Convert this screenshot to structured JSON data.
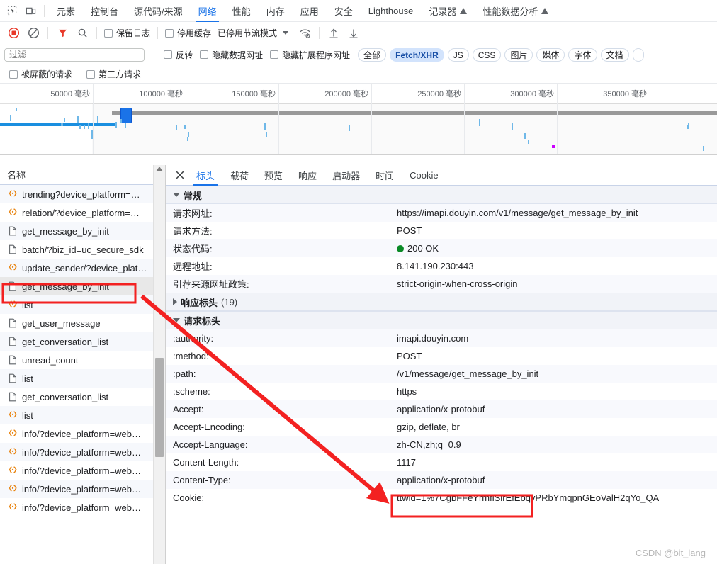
{
  "devtools": {
    "left_icons": [
      "inspect-element-icon",
      "device-toolbar-icon"
    ],
    "tabs": [
      {
        "label": "元素",
        "active": false,
        "warn": false
      },
      {
        "label": "控制台",
        "active": false,
        "warn": false
      },
      {
        "label": "源代码/来源",
        "active": false,
        "warn": false
      },
      {
        "label": "网络",
        "active": true,
        "warn": false
      },
      {
        "label": "性能",
        "active": false,
        "warn": false
      },
      {
        "label": "内存",
        "active": false,
        "warn": false
      },
      {
        "label": "应用",
        "active": false,
        "warn": false
      },
      {
        "label": "安全",
        "active": false,
        "warn": false
      },
      {
        "label": "Lighthouse",
        "active": false,
        "warn": false
      },
      {
        "label": "记录器",
        "active": false,
        "warn": true
      },
      {
        "label": "性能数据分析",
        "active": false,
        "warn": true
      }
    ]
  },
  "network_toolbar": {
    "record_icon": "record-stop-icon",
    "clear_icon": "clear-no-entry-icon",
    "filter_icon": "filter-funnel-icon",
    "search_icon": "search-icon",
    "preserve_log": "保留日志",
    "disable_cache": "停用缓存",
    "throttling": "已停用节流模式",
    "throttle_caret": "chevron-down-icon",
    "wifi_icon": "network-conditions-icon",
    "import_icon": "import-har-icon",
    "export_icon": "export-har-icon"
  },
  "filter_bar": {
    "placeholder": "过滤",
    "value": "",
    "invert": "反转",
    "hide_data_urls": "隐藏数据网址",
    "hide_extension_urls": "隐藏扩展程序网址",
    "types": [
      {
        "label": "全部",
        "selected": false
      },
      {
        "label": "Fetch/XHR",
        "selected": true
      },
      {
        "label": "JS",
        "selected": false
      },
      {
        "label": "CSS",
        "selected": false
      },
      {
        "label": "图片",
        "selected": false
      },
      {
        "label": "媒体",
        "selected": false
      },
      {
        "label": "字体",
        "selected": false
      },
      {
        "label": "文档",
        "selected": false
      }
    ],
    "blocked_requests": "被屏蔽的请求",
    "third_party": "第三方请求"
  },
  "overview": {
    "ticks": [
      "50000 毫秒",
      "100000 毫秒",
      "150000 毫秒",
      "200000 毫秒",
      "250000 毫秒",
      "300000 毫秒",
      "350000 毫秒"
    ]
  },
  "requests": {
    "column_header": "名称",
    "rows": [
      {
        "name": "trending?device_platform=…",
        "icon": "json-icon",
        "selected": false
      },
      {
        "name": "relation/?device_platform=…",
        "icon": "json-icon",
        "selected": false
      },
      {
        "name": "get_message_by_init",
        "icon": "doc-icon",
        "selected": false
      },
      {
        "name": "batch/?biz_id=uc_secure_sdk",
        "icon": "doc-icon",
        "selected": false
      },
      {
        "name": "update_sender/?device_plat…",
        "icon": "json-icon",
        "selected": false
      },
      {
        "name": "get_message_by_init",
        "icon": "doc-icon",
        "selected": true
      },
      {
        "name": "list",
        "icon": "json-icon",
        "selected": false
      },
      {
        "name": "get_user_message",
        "icon": "doc-icon",
        "selected": false
      },
      {
        "name": "get_conversation_list",
        "icon": "doc-icon",
        "selected": false
      },
      {
        "name": "unread_count",
        "icon": "doc-icon",
        "selected": false
      },
      {
        "name": "list",
        "icon": "doc-icon",
        "selected": false
      },
      {
        "name": "get_conversation_list",
        "icon": "doc-icon",
        "selected": false
      },
      {
        "name": "list",
        "icon": "json-icon",
        "selected": false
      },
      {
        "name": "info/?device_platform=web…",
        "icon": "json-icon",
        "selected": false
      },
      {
        "name": "info/?device_platform=web…",
        "icon": "json-icon",
        "selected": false
      },
      {
        "name": "info/?device_platform=web…",
        "icon": "json-icon",
        "selected": false
      },
      {
        "name": "info/?device_platform=web…",
        "icon": "json-icon",
        "selected": false
      },
      {
        "name": "info/?device_platform=web…",
        "icon": "json-icon",
        "selected": false
      }
    ]
  },
  "detail": {
    "close_label": "✕",
    "tabs": [
      {
        "label": "标头",
        "active": true
      },
      {
        "label": "载荷",
        "active": false
      },
      {
        "label": "预览",
        "active": false
      },
      {
        "label": "响应",
        "active": false
      },
      {
        "label": "启动器",
        "active": false
      },
      {
        "label": "时间",
        "active": false
      },
      {
        "label": "Cookie",
        "active": false
      }
    ],
    "general": {
      "title": "常规",
      "rows": [
        {
          "key": "请求网址:",
          "value": "https://imapi.douyin.com/v1/message/get_message_by_init",
          "status": false
        },
        {
          "key": "请求方法:",
          "value": "POST",
          "status": false
        },
        {
          "key": "状态代码:",
          "value": "200 OK",
          "status": true
        },
        {
          "key": "远程地址:",
          "value": "8.141.190.230:443",
          "status": false
        },
        {
          "key": "引荐来源网址政策:",
          "value": "strict-origin-when-cross-origin",
          "status": false
        }
      ]
    },
    "response_headers": {
      "title": "响应标头",
      "count": "(19)"
    },
    "request_headers": {
      "title": "请求标头",
      "rows": [
        {
          "key": ":authority:",
          "value": "imapi.douyin.com"
        },
        {
          "key": ":method:",
          "value": "POST"
        },
        {
          "key": ":path:",
          "value": "/v1/message/get_message_by_init"
        },
        {
          "key": ":scheme:",
          "value": "https"
        },
        {
          "key": "Accept:",
          "value": "application/x-protobuf"
        },
        {
          "key": "Accept-Encoding:",
          "value": "gzip, deflate, br"
        },
        {
          "key": "Accept-Language:",
          "value": "zh-CN,zh;q=0.9"
        },
        {
          "key": "Content-Length:",
          "value": "1117"
        },
        {
          "key": "Content-Type:",
          "value": "application/x-protobuf"
        },
        {
          "key": "Cookie:",
          "value": "ttwid=1%7CgbFFeYrmfiSlrEfEbqvPRbYmqpnGEoValH2qYo_QA"
        }
      ]
    }
  },
  "annotations": {
    "highlight_color": "#f32121",
    "source_box": "get_message_by_init",
    "target_box": "application/x-protobuf"
  },
  "watermark": "CSDN @bit_lang"
}
